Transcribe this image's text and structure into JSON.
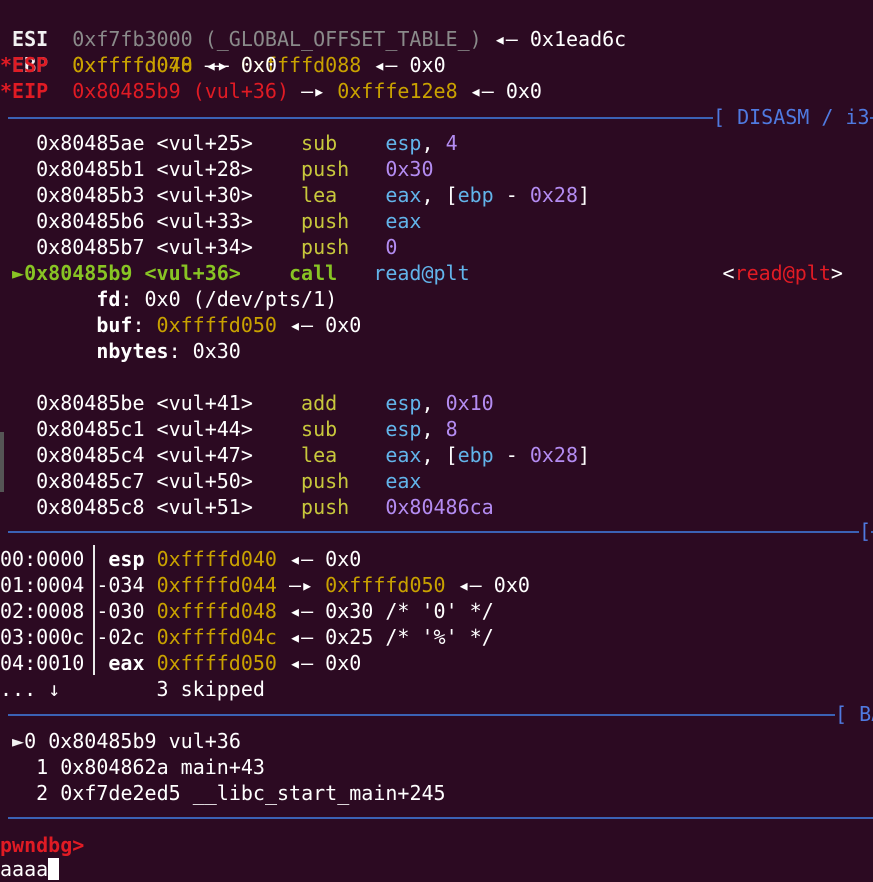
{
  "regs": [
    {
      "star": " ",
      "name": "ESI",
      "val": "0xf7fb3000 (_GLOBAL_OFFSET_TABLE_)",
      "arrow": "◂—",
      "tail": "0x1ead6c"
    },
    {
      "star": " ",
      "name": "EBP",
      "val": "0xffffd078",
      "arrow": "—▸",
      "mid": "0xffffd088",
      "arrow2": "◂—",
      "tail": "0x0"
    },
    {
      "star": "*",
      "name": "ESP",
      "val": "0xffffd040",
      "arrow": "◂—",
      "tail": "0x0"
    },
    {
      "star": "*",
      "name": "EIP",
      "val": "0x80485b9 (vul+36)",
      "arrow": "—▸",
      "mid": "0xfffe12e8",
      "arrow2": "◂—",
      "tail": "0x0"
    }
  ],
  "disasm_title": "[ DISASM / i3",
  "disasm": [
    {
      "addr": "0x80485ae",
      "sym": "<vul+25>",
      "op": "sub",
      "a1": "esp",
      "a2": ", ",
      "a3": "4"
    },
    {
      "addr": "0x80485b1",
      "sym": "<vul+28>",
      "op": "push",
      "a1": "",
      "a2": "",
      "a3": "0x30"
    },
    {
      "addr": "0x80485b3",
      "sym": "<vul+30>",
      "op": "lea",
      "a1": "eax",
      "a2": ", [",
      "a3": "ebp",
      "a4": " - ",
      "a5": "0x28",
      "a6": "]"
    },
    {
      "addr": "0x80485b6",
      "sym": "<vul+33>",
      "op": "push",
      "a1": "eax"
    },
    {
      "addr": "0x80485b7",
      "sym": "<vul+34>",
      "op": "push",
      "a3": "0"
    },
    {
      "addr": "0x80485b9",
      "sym": "<vul+36>",
      "op": "call",
      "target": "read@plt",
      "cmt_open": "<",
      "cmt": "read@plt",
      "cmt_close": ">",
      "marker": "►"
    }
  ],
  "args": [
    {
      "name": "fd",
      "sep": ": ",
      "val": "0x0 (/dev/pts/1)"
    },
    {
      "name": "buf",
      "sep": ": ",
      "val": "0xffffd050",
      "arrow": "◂—",
      "tail": "0x0"
    },
    {
      "name": "nbytes",
      "sep": ": ",
      "val": "0x30"
    }
  ],
  "disasm2": [
    {
      "addr": "0x80485be",
      "sym": "<vul+41>",
      "op": "add",
      "a1": "esp",
      "a2": ", ",
      "a3": "0x10"
    },
    {
      "addr": "0x80485c1",
      "sym": "<vul+44>",
      "op": "sub",
      "a1": "esp",
      "a2": ", ",
      "a3": "8"
    },
    {
      "addr": "0x80485c4",
      "sym": "<vul+47>",
      "op": "lea",
      "a1": "eax",
      "a2": ", [",
      "a3": "ebp",
      "a4": " - ",
      "a5": "0x28",
      "a6": "]"
    },
    {
      "addr": "0x80485c7",
      "sym": "<vul+50>",
      "op": "push",
      "a1": "eax"
    },
    {
      "addr": "0x80485c8",
      "sym": "<vul+51>",
      "op": "push",
      "a3": "0x80486ca"
    }
  ],
  "stack_title": "[",
  "stack": [
    {
      "idx": "00:0000",
      "off": "esp",
      "bold": true,
      "addr": "0xffffd040",
      "arrow": "◂—",
      "tail": "0x0"
    },
    {
      "idx": "01:0004",
      "off": "-034",
      "addr": "0xffffd044",
      "arrow": "—▸",
      "mid": "0xffffd050",
      "arrow2": "◂—",
      "tail": "0x0"
    },
    {
      "idx": "02:0008",
      "off": "-030",
      "addr": "0xffffd048",
      "arrow": "◂—",
      "tail": "0x30 /* '0' */"
    },
    {
      "idx": "03:000c",
      "off": "-02c",
      "addr": "0xffffd04c",
      "arrow": "◂—",
      "tail": "0x25 /* '%' */"
    },
    {
      "idx": "04:0010",
      "off": "eax",
      "bold": true,
      "addr": "0xffffd050",
      "arrow": "◂—",
      "tail": "0x0"
    }
  ],
  "skipped": {
    "dots": "... ↓",
    "text": "3 skipped"
  },
  "bt_title": "[ BA",
  "backtrace": [
    {
      "marker": "►",
      "n": "0",
      "addr": "0x80485b9",
      "sym": "vul+36"
    },
    {
      "marker": " ",
      "n": "1",
      "addr": "0x804862a",
      "sym": "main+43"
    },
    {
      "marker": " ",
      "n": "2",
      "addr": "0xf7de2ed5",
      "sym": "__libc_start_main+245"
    }
  ],
  "prompt": "pwndbg>",
  "input": "aaaa"
}
